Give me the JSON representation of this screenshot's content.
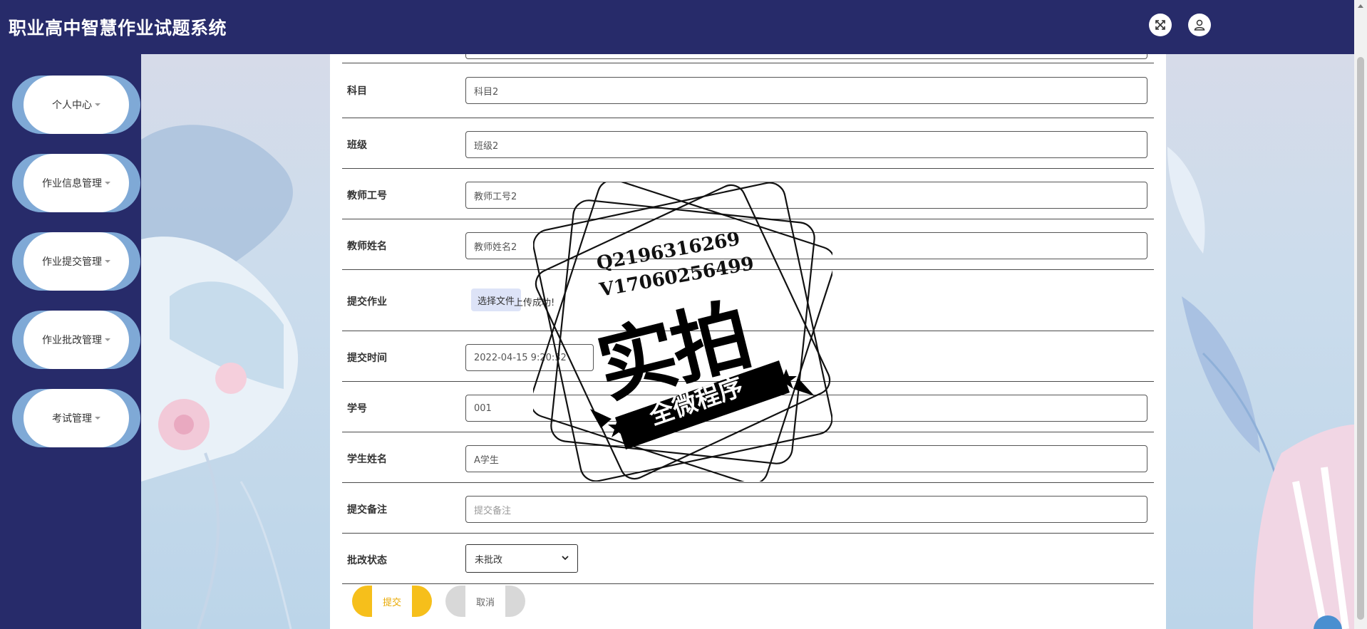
{
  "app": {
    "title": "职业高中智慧作业试题系统"
  },
  "header": {
    "fullscreen_icon": "fullscreen-icon",
    "user_icon": "user-icon"
  },
  "sidebar": {
    "items": [
      {
        "label": "个人中心"
      },
      {
        "label": "作业信息管理"
      },
      {
        "label": "作业提交管理"
      },
      {
        "label": "作业批改管理"
      },
      {
        "label": "考试管理"
      }
    ]
  },
  "form": {
    "subject": {
      "label": "科目",
      "value": "科目2"
    },
    "class": {
      "label": "班级",
      "value": "班级2"
    },
    "teacher_id": {
      "label": "教师工号",
      "value": "教师工号2"
    },
    "teacher_name": {
      "label": "教师姓名",
      "value": "教师姓名2"
    },
    "homework": {
      "label": "提交作业",
      "button": "选择文件",
      "status": "上传成功!"
    },
    "submit_time": {
      "label": "提交时间",
      "value": "2022-04-15 9:20:32"
    },
    "student_id": {
      "label": "学号",
      "value": "001"
    },
    "student_name": {
      "label": "学生姓名",
      "value": "A学生"
    },
    "remark": {
      "label": "提交备注",
      "placeholder": "提交备注"
    },
    "review_status": {
      "label": "批改状态",
      "selected": "未批改"
    },
    "submit_label": "提交",
    "cancel_label": "取消"
  },
  "watermark": {
    "line1": "Q2196316269",
    "line2": "V17060256499",
    "big": "实拍",
    "banner": "全微程序"
  },
  "colors": {
    "header_bg": "#272b6a",
    "sidebar_accent": "#7fa9d6",
    "submit": "#f6bf1b",
    "cancel": "#d8d8d8"
  }
}
